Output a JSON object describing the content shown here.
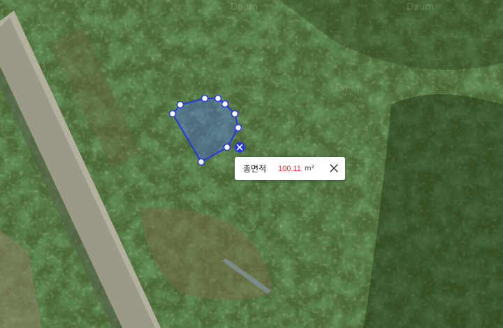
{
  "measurement": {
    "label": "총면적",
    "value": "100.11",
    "unit": "m²",
    "close_icon": "close-icon",
    "delete_icon": "delete-vertex-icon",
    "polygon_color": "#2438e8",
    "value_color": "#e8332a"
  },
  "watermark": {
    "brand": "Daum"
  }
}
